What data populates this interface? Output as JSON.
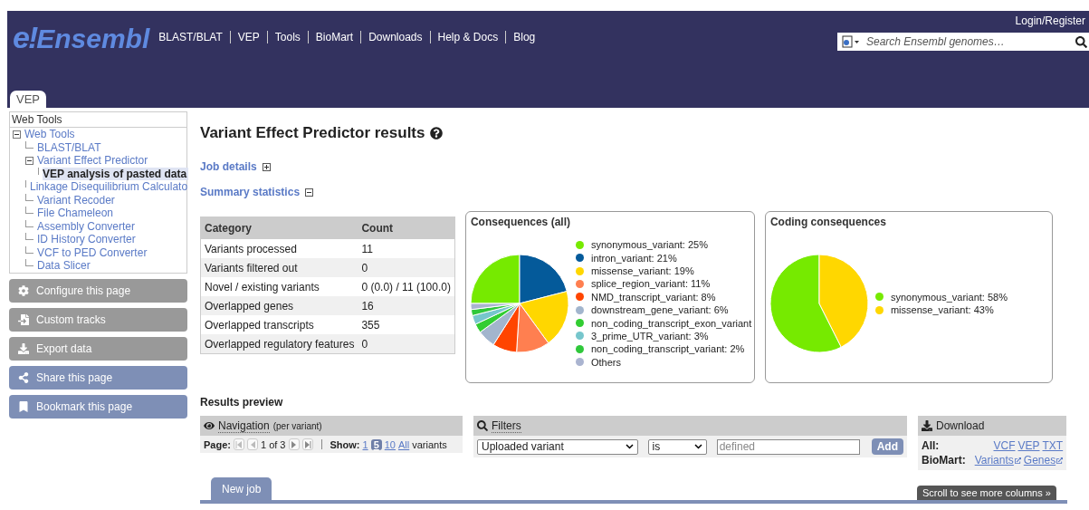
{
  "header": {
    "logo_mark": "e!",
    "logo_text": "Ensembl",
    "nav": [
      "BLAST/BLAT",
      "VEP",
      "Tools",
      "BioMart",
      "Downloads",
      "Help & Docs",
      "Blog"
    ],
    "login": "Login/Register",
    "search": {
      "placeholder": "Search Ensembl genomes…"
    },
    "tabs": [
      {
        "label": "VEP",
        "selected": true
      }
    ]
  },
  "sidebar": {
    "title": "Web Tools",
    "tree": [
      {
        "label": "Web Tools",
        "expanded": true,
        "selected": false,
        "children": [
          {
            "label": "BLAST/BLAT",
            "selected": false
          },
          {
            "label": "Variant Effect Predictor",
            "expanded": true,
            "selected": false,
            "children": [
              {
                "label": "VEP analysis of pasted data",
                "selected": true
              }
            ]
          },
          {
            "label": "Linkage Disequilibrium Calculato",
            "selected": false
          },
          {
            "label": "Variant Recoder",
            "selected": false
          },
          {
            "label": "File Chameleon",
            "selected": false
          },
          {
            "label": "Assembly Converter",
            "selected": false
          },
          {
            "label": "ID History Converter",
            "selected": false
          },
          {
            "label": "VCF to PED Converter",
            "selected": false
          },
          {
            "label": "Data Slicer",
            "selected": false
          }
        ]
      }
    ],
    "actions": [
      {
        "label": "Configure this page",
        "kind": "gear",
        "disabled": true
      },
      {
        "label": "Custom tracks",
        "kind": "tracks",
        "disabled": true
      },
      {
        "label": "Export data",
        "kind": "export",
        "disabled": true
      },
      {
        "label": "Share this page",
        "kind": "share",
        "disabled": false
      },
      {
        "label": "Bookmark this page",
        "kind": "bookmark",
        "disabled": false
      }
    ]
  },
  "main": {
    "title": "Variant Effect Predictor results",
    "sections": [
      {
        "label": "Job details",
        "expanded": false
      },
      {
        "label": "Summary statistics",
        "expanded": true
      }
    ],
    "stats": {
      "columns": [
        "Category",
        "Count"
      ],
      "rows": [
        [
          "Variants processed",
          "11"
        ],
        [
          "Variants filtered out",
          "0"
        ],
        [
          "Novel / existing variants",
          "0 (0.0) / 11 (100.0)"
        ],
        [
          "Overlapped genes",
          "16"
        ],
        [
          "Overlapped transcripts",
          "355"
        ],
        [
          "Overlapped regulatory features",
          "0"
        ]
      ]
    },
    "charts": [
      {
        "legend": [
          {
            "text": "synonymous_variant: 25%",
            "color": "#76ea00"
          },
          {
            "text": "intron_variant: 21%",
            "color": "#045a9a"
          },
          {
            "text": "missense_variant: 19%",
            "color": "#ffd700"
          },
          {
            "text": "splice_region_variant: 11%",
            "color": "#ff7f50"
          },
          {
            "text": "NMD_transcript_variant: 8%",
            "color": "#ff4500"
          },
          {
            "text": "downstream_gene_variant: 6%",
            "color": "#a2b5cd"
          },
          {
            "text": "non_coding_transcript_exon_variant",
            "color": "#32cd32"
          },
          {
            "text": "3_prime_UTR_variant: 3%",
            "color": "#76c6cc"
          },
          {
            "text": "non_coding_transcript_variant: 2%",
            "color": "#2fc83a"
          },
          {
            "text": "Others",
            "color": "#aab4d0"
          }
        ],
        "chart_data": {
          "type": "pie",
          "title": "Consequences (all)",
          "values": [
            25,
            21,
            19,
            11,
            8,
            6,
            3,
            3,
            2,
            2
          ]
        }
      },
      {
        "legend": [
          {
            "text": "synonymous_variant: 58%",
            "color": "#76ea00"
          },
          {
            "text": "missense_variant: 43%",
            "color": "#ffd700"
          }
        ],
        "chart_data": {
          "type": "pie",
          "title": "Coding consequences",
          "values": [
            58,
            43
          ]
        }
      }
    ],
    "results_title": "Results preview",
    "navigation": {
      "title": "Navigation",
      "note": "(per variant)",
      "page_label": "Page:",
      "page": "1 of 3",
      "show_label": "Show:",
      "sizes": [
        {
          "label": "1",
          "selected": false
        },
        {
          "label": "5",
          "selected": true
        },
        {
          "label": "10",
          "selected": false
        },
        {
          "label": "All",
          "selected": false
        }
      ],
      "unit": "variants"
    },
    "filters": {
      "title": "Filters",
      "field": "Uploaded variant",
      "operator": "is",
      "value_placeholder": "defined",
      "add": "Add"
    },
    "download": {
      "title": "Download",
      "rows": [
        {
          "label": "All:",
          "links": [
            {
              "text": "VCF",
              "external": false
            },
            {
              "text": "VEP",
              "external": false
            },
            {
              "text": "TXT",
              "external": false
            }
          ]
        },
        {
          "label": "BioMart:",
          "links": [
            {
              "text": "Variants",
              "external": true
            },
            {
              "text": "Genes",
              "external": true
            }
          ]
        }
      ]
    },
    "new_job": "New job",
    "tooltip": "Scroll to see more columns »"
  }
}
